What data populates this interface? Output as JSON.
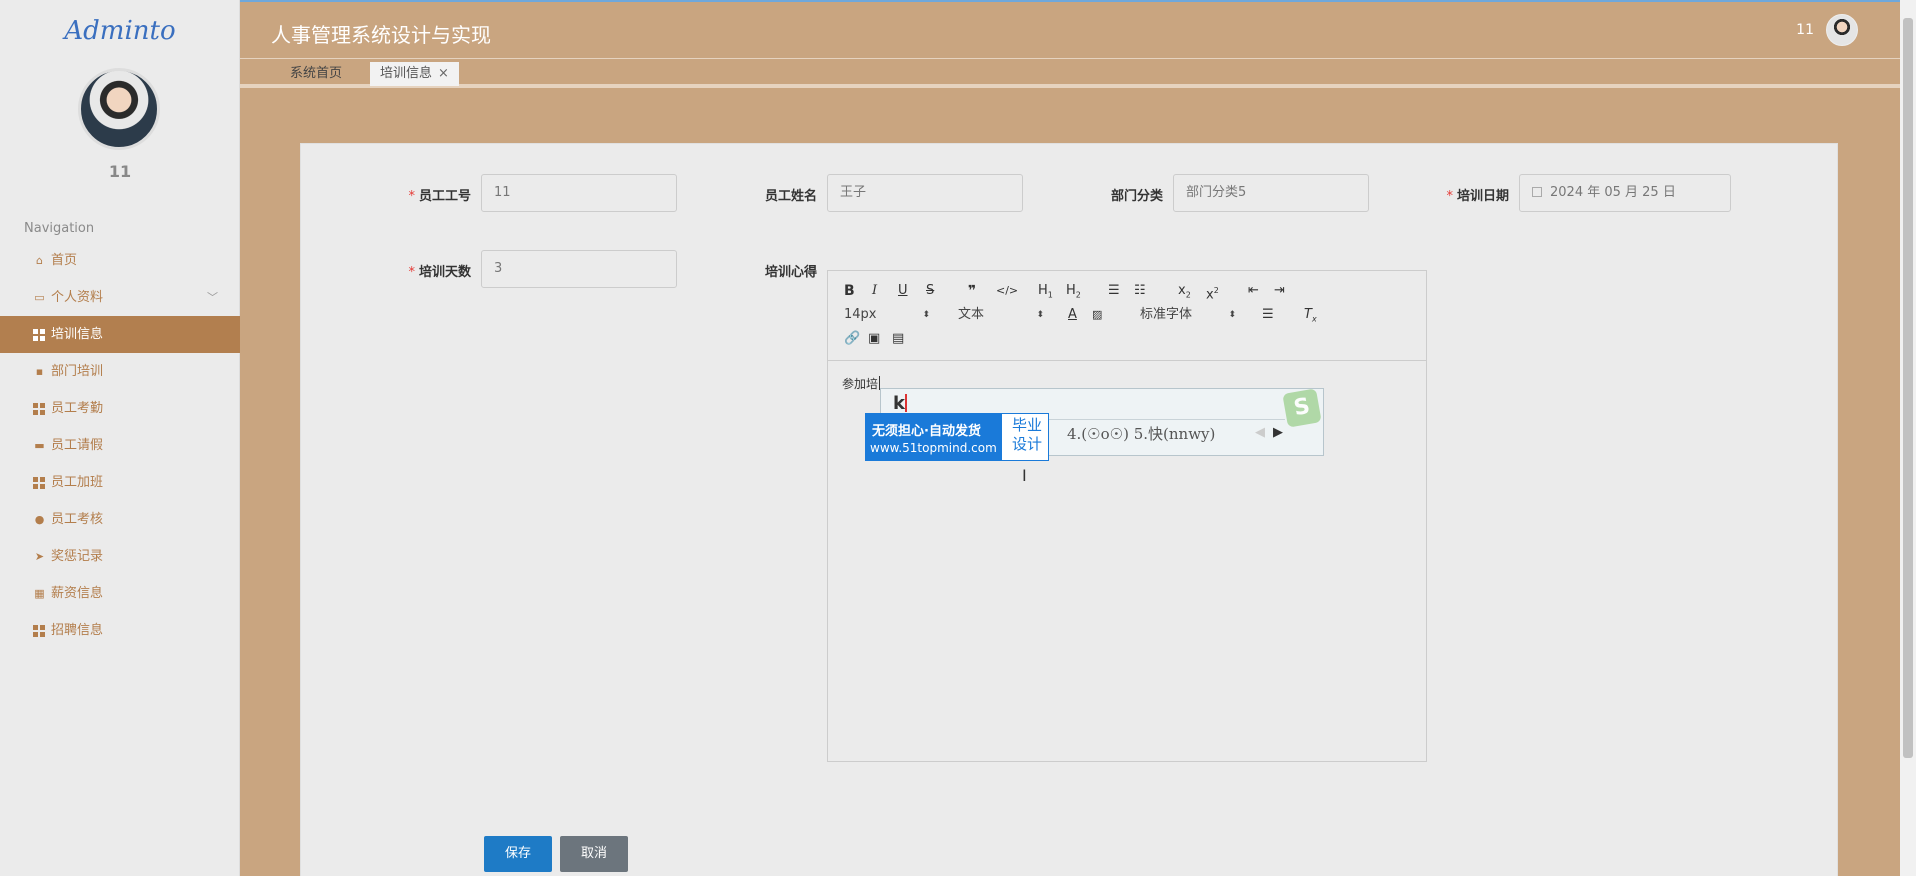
{
  "app": {
    "logo_text": "Adminto",
    "title": "人事管理系统设计与实现"
  },
  "user": {
    "name": "11",
    "header_name": "11"
  },
  "sidebar": {
    "nav_title": "Navigation",
    "items": [
      {
        "label": "首页",
        "icon": "home-icon"
      },
      {
        "label": "个人资料",
        "icon": "profile-icon"
      },
      {
        "label": "培训信息",
        "icon": "grid-icon",
        "active": true
      },
      {
        "label": "部门培训",
        "icon": "chat-icon"
      },
      {
        "label": "员工考勤",
        "icon": "grid-icon"
      },
      {
        "label": "员工请假",
        "icon": "monitor-icon"
      },
      {
        "label": "员工加班",
        "icon": "grid-icon"
      },
      {
        "label": "员工考核",
        "icon": "user-icon"
      },
      {
        "label": "奖惩记录",
        "icon": "send-icon"
      },
      {
        "label": "薪资信息",
        "icon": "chart-icon"
      },
      {
        "label": "招聘信息",
        "icon": "grid-icon"
      }
    ]
  },
  "tabs": [
    {
      "label": "系统首页"
    },
    {
      "label": "培训信息",
      "close": "×"
    }
  ],
  "form": {
    "employee_id": {
      "label": "员工工号",
      "required": "*",
      "value": "11"
    },
    "employee_name": {
      "label": "员工姓名",
      "value": "王子"
    },
    "department": {
      "label": "部门分类",
      "value": "部门分类5"
    },
    "training_date": {
      "label": "培训日期",
      "required": "*",
      "value": "2024 年 05 月 25 日"
    },
    "training_days": {
      "label": "培训天数",
      "required": "*",
      "value": "3"
    },
    "training_notes": {
      "label": "培训心得",
      "content": "参加培"
    }
  },
  "editor_toolbar": {
    "font_size": "14px",
    "paragraph": "文本",
    "font_family": "标准字体"
  },
  "ime": {
    "composition": "k",
    "candidates": "4.(☉o☉)  5.快(nnwy)",
    "ad_line1": "无须担心·自动发货",
    "ad_line2": "www.51topmind.com",
    "ad_right1": "毕业",
    "ad_right2": "设计"
  },
  "buttons": {
    "save": "保存",
    "cancel": "取消"
  }
}
